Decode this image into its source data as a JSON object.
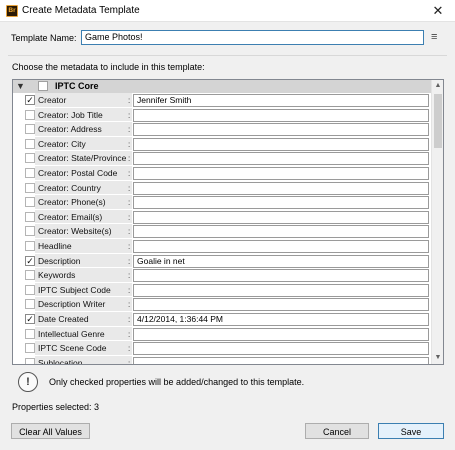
{
  "window": {
    "app_icon": "Br",
    "title": "Create Metadata Template",
    "close_glyph": "✕"
  },
  "template_name": {
    "label": "Template Name:",
    "value": "Game Photos!",
    "menu_icon": "≡"
  },
  "choose_label": "Choose the metadata to include in this template:",
  "group": {
    "name": "IPTC Core",
    "expanded": true,
    "checked": false
  },
  "rows": [
    {
      "label": "Creator",
      "checked": true,
      "value": "Jennifer Smith"
    },
    {
      "label": "Creator: Job Title",
      "checked": false,
      "value": ""
    },
    {
      "label": "Creator: Address",
      "checked": false,
      "value": ""
    },
    {
      "label": "Creator: City",
      "checked": false,
      "value": ""
    },
    {
      "label": "Creator: State/Province",
      "checked": false,
      "value": ""
    },
    {
      "label": "Creator: Postal Code",
      "checked": false,
      "value": ""
    },
    {
      "label": "Creator: Country",
      "checked": false,
      "value": ""
    },
    {
      "label": "Creator: Phone(s)",
      "checked": false,
      "value": ""
    },
    {
      "label": "Creator: Email(s)",
      "checked": false,
      "value": ""
    },
    {
      "label": "Creator: Website(s)",
      "checked": false,
      "value": ""
    },
    {
      "label": "Headline",
      "checked": false,
      "value": ""
    },
    {
      "label": "Description",
      "checked": true,
      "value": "Goalie in net"
    },
    {
      "label": "Keywords",
      "checked": false,
      "value": ""
    },
    {
      "label": "IPTC Subject Code",
      "checked": false,
      "value": ""
    },
    {
      "label": "Description Writer",
      "checked": false,
      "value": ""
    },
    {
      "label": "Date Created",
      "checked": true,
      "value": "4/12/2014, 1:36:44 PM"
    },
    {
      "label": "Intellectual Genre",
      "checked": false,
      "value": ""
    },
    {
      "label": "IPTC Scene Code",
      "checked": false,
      "value": ""
    },
    {
      "label": "Sublocation",
      "checked": false,
      "value": ""
    }
  ],
  "info": {
    "icon": "!",
    "text": "Only checked properties will be added/changed to this template."
  },
  "properties": {
    "label": "Properties selected:",
    "count": "3"
  },
  "buttons": {
    "clear": "Clear All Values",
    "cancel": "Cancel",
    "save": "Save"
  }
}
